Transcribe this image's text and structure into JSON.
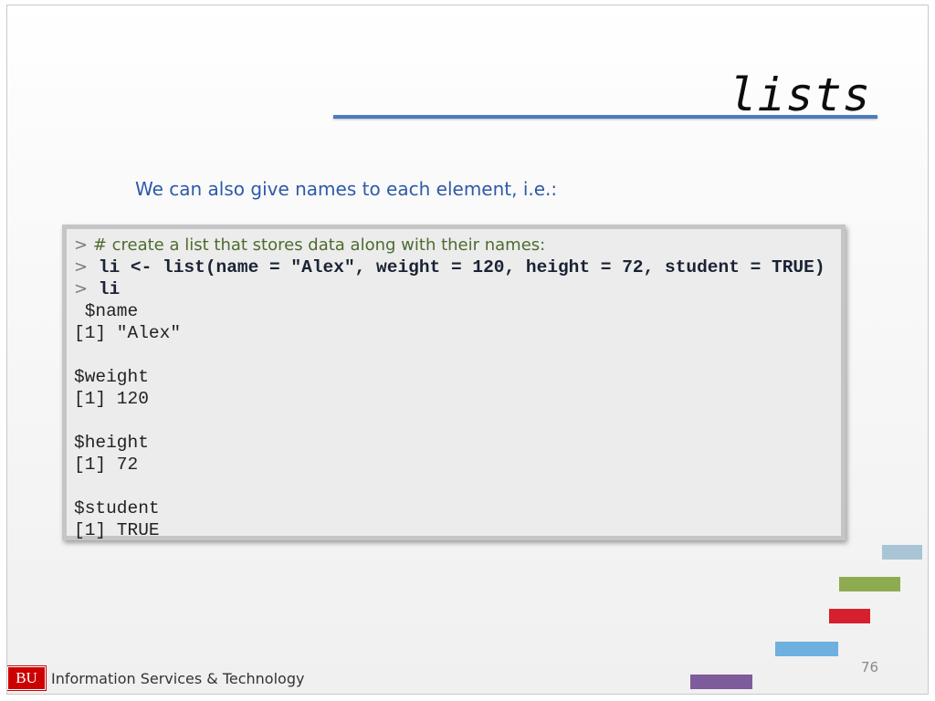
{
  "slide": {
    "title": "lists",
    "subtitle": "We can also give names to each element, i.e.:",
    "page_number": "76"
  },
  "code": {
    "lines": [
      {
        "type": "comment",
        "prompt": ">",
        "text": " # create a list that stores data along with their names:"
      },
      {
        "type": "command",
        "prompt": ">",
        "text": " li <- list(name = \"Alex\", weight = 120, height = 72, student = TRUE)"
      },
      {
        "type": "command",
        "prompt": ">",
        "text": " li"
      },
      {
        "type": "output",
        "text": " $name"
      },
      {
        "type": "output",
        "text": "[1] \"Alex\""
      },
      {
        "type": "output",
        "text": ""
      },
      {
        "type": "output",
        "text": "$weight"
      },
      {
        "type": "output",
        "text": "[1] 120"
      },
      {
        "type": "output",
        "text": ""
      },
      {
        "type": "output",
        "text": "$height"
      },
      {
        "type": "output",
        "text": "[1] 72"
      },
      {
        "type": "output",
        "text": ""
      },
      {
        "type": "output",
        "text": "$student"
      },
      {
        "type": "output",
        "text": "[1] TRUE"
      }
    ]
  },
  "footer": {
    "logo_text": "BU",
    "org_name": "Information Services & Technology"
  },
  "colors": {
    "accent_rule": "#4a7cbf",
    "subtitle": "#2e5aa8",
    "deco_bars": [
      "#a9c4d4",
      "#8fab52",
      "#d6202e",
      "#6eb0df",
      "#7e5b9b"
    ]
  }
}
